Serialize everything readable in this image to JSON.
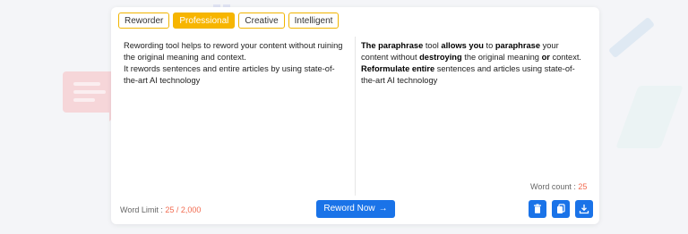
{
  "modes": {
    "reworder": "Reworder",
    "professional": "Professional",
    "creative": "Creative",
    "intelligent": "Intelligent",
    "active": "professional"
  },
  "input": {
    "line1": "Rewording tool helps to reword your content without ruining the original meaning and context.",
    "line2": "It rewords sentences and entire articles by using state-of-the-art AI technology"
  },
  "output": {
    "s1_b1": "The paraphrase",
    "s1_t1": " tool ",
    "s1_b2": "allows you",
    "s1_t2": " to ",
    "s1_b3": "paraphrase",
    "s1_t3": " your content without ",
    "s1_b4": "destroying",
    "s1_t4": " the original meaning ",
    "s1_b5": "or",
    "s1_t5": " context.",
    "s2_b1": "Reformulate entire",
    "s2_t1": " sentences and articles using state-of-the-art AI technology"
  },
  "word_count": {
    "label": "Word count : ",
    "value": "25"
  },
  "word_limit": {
    "label": "Word Limit : ",
    "value": "25 / 2,000"
  },
  "actions": {
    "reword_label": "Reword Now",
    "reword_arrow": "→",
    "delete_icon": "trash-icon",
    "copy_icon": "copy-icon",
    "download_icon": "download-icon"
  },
  "colors": {
    "accent": "#1a73e8",
    "mode_active": "#f7b500",
    "count": "#f26b50"
  }
}
